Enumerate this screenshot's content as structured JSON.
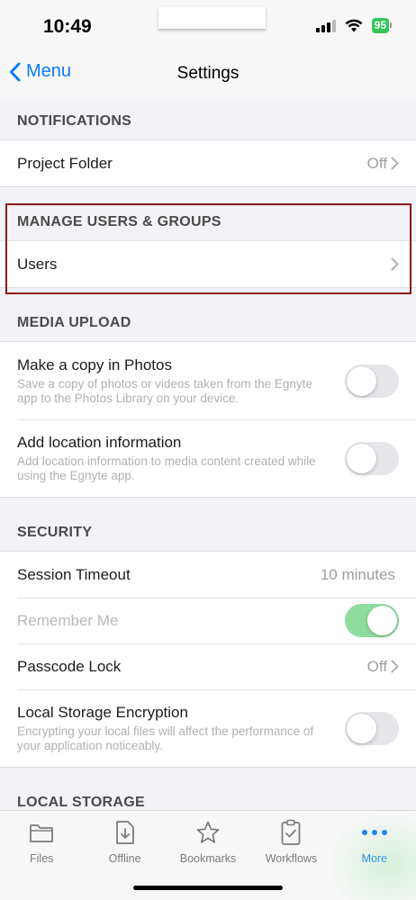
{
  "status_bar": {
    "time": "10:49",
    "battery": "95"
  },
  "nav": {
    "back_label": "Menu",
    "title": "Settings"
  },
  "sections": {
    "notifications": {
      "header": "NOTIFICATIONS",
      "project_folder": {
        "label": "Project Folder",
        "value": "Off"
      }
    },
    "manage_users": {
      "header": "MANAGE USERS & GROUPS",
      "users": {
        "label": "Users"
      }
    },
    "media_upload": {
      "header": "MEDIA UPLOAD",
      "copy_in_photos": {
        "label": "Make a copy in Photos",
        "description": "Save a copy of photos or videos taken from the Egnyte app to the Photos Library on your device.",
        "enabled": false
      },
      "location_info": {
        "label": "Add location information",
        "description": "Add location information to media content created while using the Egnyte app.",
        "enabled": false
      }
    },
    "security": {
      "header": "SECURITY",
      "session_timeout": {
        "label": "Session Timeout",
        "value": "10 minutes"
      },
      "remember_me": {
        "label": "Remember Me",
        "enabled": true,
        "disabled": true
      },
      "passcode_lock": {
        "label": "Passcode Lock",
        "value": "Off"
      },
      "local_storage_encryption": {
        "label": "Local Storage Encryption",
        "description": "Encrypting your local files will affect the performance of your application noticeably.",
        "enabled": false
      }
    },
    "local_storage": {
      "header": "LOCAL STORAGE"
    }
  },
  "tab_bar": {
    "files": "Files",
    "offline": "Offline",
    "bookmarks": "Bookmarks",
    "workflows": "Workflows",
    "more": "More"
  },
  "colors": {
    "accent": "#0a7aff",
    "toggle_on": "#8fdc9f",
    "highlight": "#8b1a1a"
  }
}
